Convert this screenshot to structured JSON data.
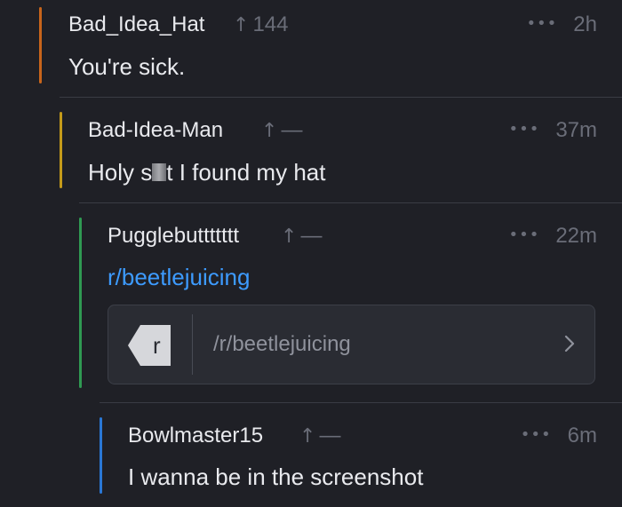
{
  "comments": [
    {
      "username": "Bad_Idea_Hat",
      "votes": "144",
      "time": "2h",
      "text": "You're sick.",
      "thread_color": "#c8651b"
    },
    {
      "username": "Bad-Idea-Man",
      "votes": "—",
      "time": "37m",
      "text_before": "Holy s",
      "text_after": "t I found my hat",
      "thread_color": "#c49a1a"
    },
    {
      "username": "Pugglebuttttttt",
      "votes": "—",
      "time": "22m",
      "link_text": "r/beetlejuicing",
      "link_card": {
        "icon_letter": "r",
        "url": "/r/beetlejuicing"
      },
      "thread_color": "#2f9a52"
    },
    {
      "username": "Bowlmaster15",
      "votes": "—",
      "time": "6m",
      "text": "I wanna be in the screenshot",
      "thread_color": "#2a78d6"
    }
  ],
  "icons": {
    "upvote": "up-arrow-icon",
    "more": "more-dots-icon",
    "chevron": "chevron-right-icon"
  },
  "colors": {
    "background": "#1f2026",
    "link": "#3d9bff",
    "muted": "#6a6d78"
  }
}
